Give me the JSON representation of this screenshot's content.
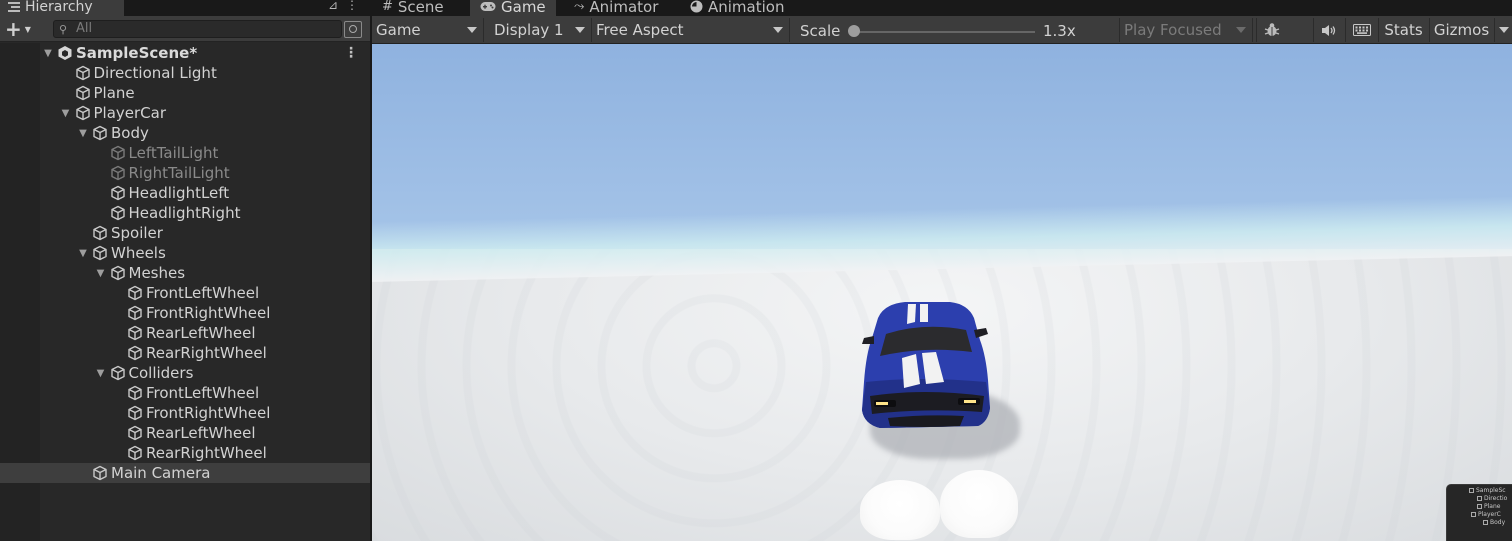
{
  "hierarchy": {
    "tab_label": "Hierarchy",
    "search_placeholder": "All",
    "rows": [
      {
        "label": "SampleScene*",
        "depth": 0,
        "expanded": true,
        "type": "scene"
      },
      {
        "label": "Directional Light",
        "depth": 1,
        "expanded": null,
        "type": "object"
      },
      {
        "label": "Plane",
        "depth": 1,
        "expanded": null,
        "type": "object"
      },
      {
        "label": "PlayerCar",
        "depth": 1,
        "expanded": true,
        "type": "object"
      },
      {
        "label": "Body",
        "depth": 2,
        "expanded": true,
        "type": "object"
      },
      {
        "label": "LeftTailLight",
        "depth": 3,
        "expanded": null,
        "type": "inactive"
      },
      {
        "label": "RightTailLight",
        "depth": 3,
        "expanded": null,
        "type": "inactive"
      },
      {
        "label": "HeadlightLeft",
        "depth": 3,
        "expanded": null,
        "type": "object"
      },
      {
        "label": "HeadlightRight",
        "depth": 3,
        "expanded": null,
        "type": "object"
      },
      {
        "label": "Spoiler",
        "depth": 2,
        "expanded": null,
        "type": "object"
      },
      {
        "label": "Wheels",
        "depth": 2,
        "expanded": true,
        "type": "object"
      },
      {
        "label": "Meshes",
        "depth": 3,
        "expanded": true,
        "type": "object"
      },
      {
        "label": "FrontLeftWheel",
        "depth": 4,
        "expanded": null,
        "type": "object"
      },
      {
        "label": "FrontRightWheel",
        "depth": 4,
        "expanded": null,
        "type": "object"
      },
      {
        "label": "RearLeftWheel",
        "depth": 4,
        "expanded": null,
        "type": "object"
      },
      {
        "label": "RearRightWheel",
        "depth": 4,
        "expanded": null,
        "type": "object"
      },
      {
        "label": "Colliders",
        "depth": 3,
        "expanded": true,
        "type": "object"
      },
      {
        "label": "FrontLeftWheel",
        "depth": 4,
        "expanded": null,
        "type": "object"
      },
      {
        "label": "FrontRightWheel",
        "depth": 4,
        "expanded": null,
        "type": "object"
      },
      {
        "label": "RearLeftWheel",
        "depth": 4,
        "expanded": null,
        "type": "object"
      },
      {
        "label": "RearRightWheel",
        "depth": 4,
        "expanded": null,
        "type": "object"
      },
      {
        "label": "Main Camera",
        "depth": 2,
        "expanded": null,
        "type": "selected"
      }
    ]
  },
  "tabs": {
    "scene": "Scene",
    "game": "Game",
    "animator": "Animator",
    "animation": "Animation"
  },
  "game_toolbar": {
    "view_mode": "Game",
    "display": "Display 1",
    "aspect": "Free Aspect",
    "scale_label": "Scale",
    "scale_value": "1.3x",
    "play_mode": "Play Focused",
    "stats": "Stats",
    "gizmos": "Gizmos"
  },
  "mini_overlay": {
    "rows": [
      "SampleSc",
      "Directio",
      "Plane",
      "PlayerC",
      "Body"
    ]
  },
  "colors": {
    "car_blue": "#2c3fae",
    "stripe": "#f2f2f2",
    "selected_row": "#3e3e3e",
    "panel_bg": "#282828",
    "toolbar_bg": "#3c3c3c"
  }
}
